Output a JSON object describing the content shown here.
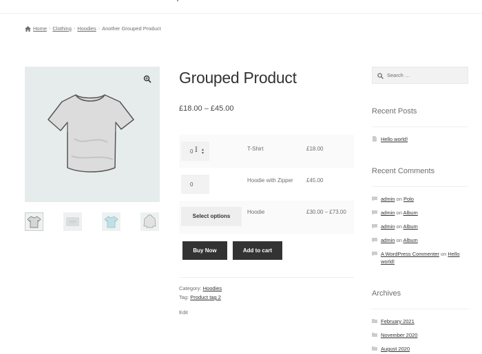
{
  "breadcrumb": {
    "items": [
      "Home",
      "Clothing",
      "Hoodies"
    ],
    "current": "Another Grouped Product",
    "separator": "›"
  },
  "product": {
    "title": "Grouped Product",
    "price_range": "£18.00 – £45.00",
    "gallery": {
      "thumbnail_count": 4,
      "image": "t-shirt",
      "zoom_icon": "magnifier-icon"
    },
    "grouped_items": [
      {
        "qty": "0",
        "name": "T-Shirt",
        "price": "£18.00",
        "control": "quantity"
      },
      {
        "qty": "0",
        "name": "Hoodie with Zipper",
        "price": "£45.00",
        "control": "quantity"
      },
      {
        "action_label": "Select options",
        "name": "Hoodie",
        "price": "£30.00 – £73.00",
        "control": "button"
      }
    ],
    "buy_now_label": "Buy Now",
    "add_to_cart_label": "Add to cart",
    "meta": {
      "category_label": "Category:",
      "category": "Hoodies",
      "tag_label": "Tag:",
      "tag": "Product tag 2",
      "edit_label": "Edit"
    }
  },
  "sidebar": {
    "search_placeholder": "Search …",
    "recent_posts": {
      "title": "Recent Posts",
      "items": [
        "Hello world!"
      ]
    },
    "recent_comments": {
      "title": "Recent Comments",
      "on_word": "on",
      "items": [
        {
          "author": "admin",
          "post": "Polo"
        },
        {
          "author": "admin",
          "post": "Album"
        },
        {
          "author": "admin",
          "post": "Album"
        },
        {
          "author": "admin",
          "post": "Album"
        },
        {
          "author": "A WordPress Commenter",
          "post": "Hello world!"
        }
      ]
    },
    "archives": {
      "title": "Archives",
      "items": [
        "February 2021",
        "November 2020",
        "August 2020"
      ]
    }
  },
  "colors": {
    "dark_button": "#333333",
    "image_bg": "#e6ecec",
    "text": "#43454b"
  }
}
